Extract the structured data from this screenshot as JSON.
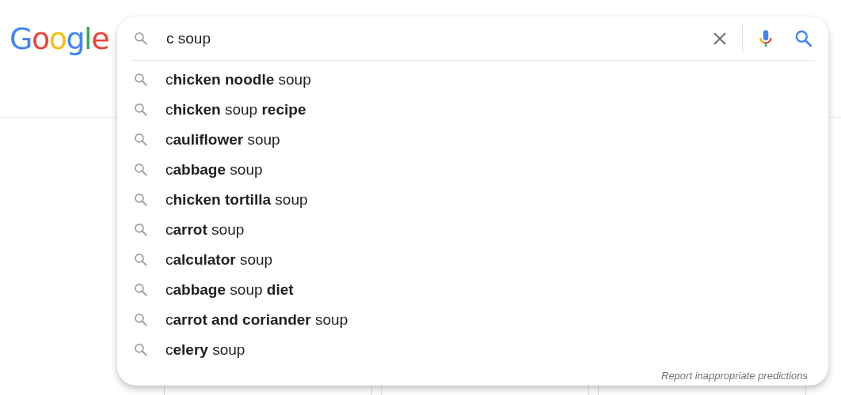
{
  "logo": {
    "text": "Google"
  },
  "search": {
    "value": "c soup"
  },
  "suggestions": [
    {
      "text": "c**hicken noodle** soup"
    },
    {
      "text": "c**hicken** soup **recipe**"
    },
    {
      "text": "c**auliflower** soup"
    },
    {
      "text": "c**abbage** soup"
    },
    {
      "text": "c**hicken tortilla** soup"
    },
    {
      "text": "c**arrot** soup"
    },
    {
      "text": "c**alculator** soup"
    },
    {
      "text": "c**abbage** soup **diet**"
    },
    {
      "text": "c**arrot and coriander** soup"
    },
    {
      "text": "c**elery** soup"
    }
  ],
  "report_link": "Report inappropriate predictions"
}
